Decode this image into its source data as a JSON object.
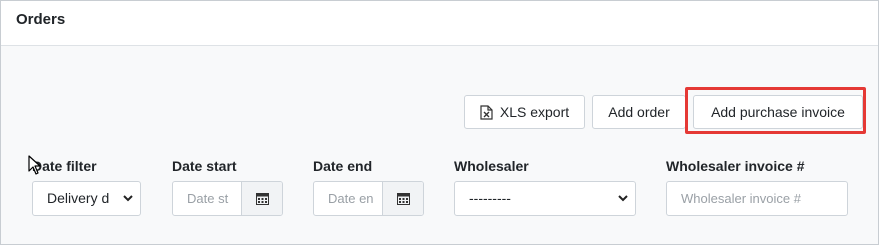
{
  "header": {
    "title": "Orders"
  },
  "toolbar": {
    "xls_export_label": "XLS export",
    "add_order_label": "Add order",
    "add_purchase_invoice_label": "Add purchase invoice"
  },
  "filters": {
    "date_filter": {
      "label": "Date filter",
      "value": "Delivery d"
    },
    "date_start": {
      "label": "Date start",
      "placeholder": "Date st"
    },
    "date_end": {
      "label": "Date end",
      "placeholder": "Date en"
    },
    "wholesaler": {
      "label": "Wholesaler",
      "value": "---------"
    },
    "wholesaler_invoice": {
      "label": "Wholesaler invoice #",
      "placeholder": "Wholesaler invoice #"
    }
  },
  "colors": {
    "highlight": "#e53935",
    "header_bg": "#ffffff",
    "body_bg": "#f8f9fa"
  },
  "icons": [
    "xls-file-icon",
    "calendar-icon",
    "chevron-down-icon",
    "mouse-pointer-icon"
  ]
}
